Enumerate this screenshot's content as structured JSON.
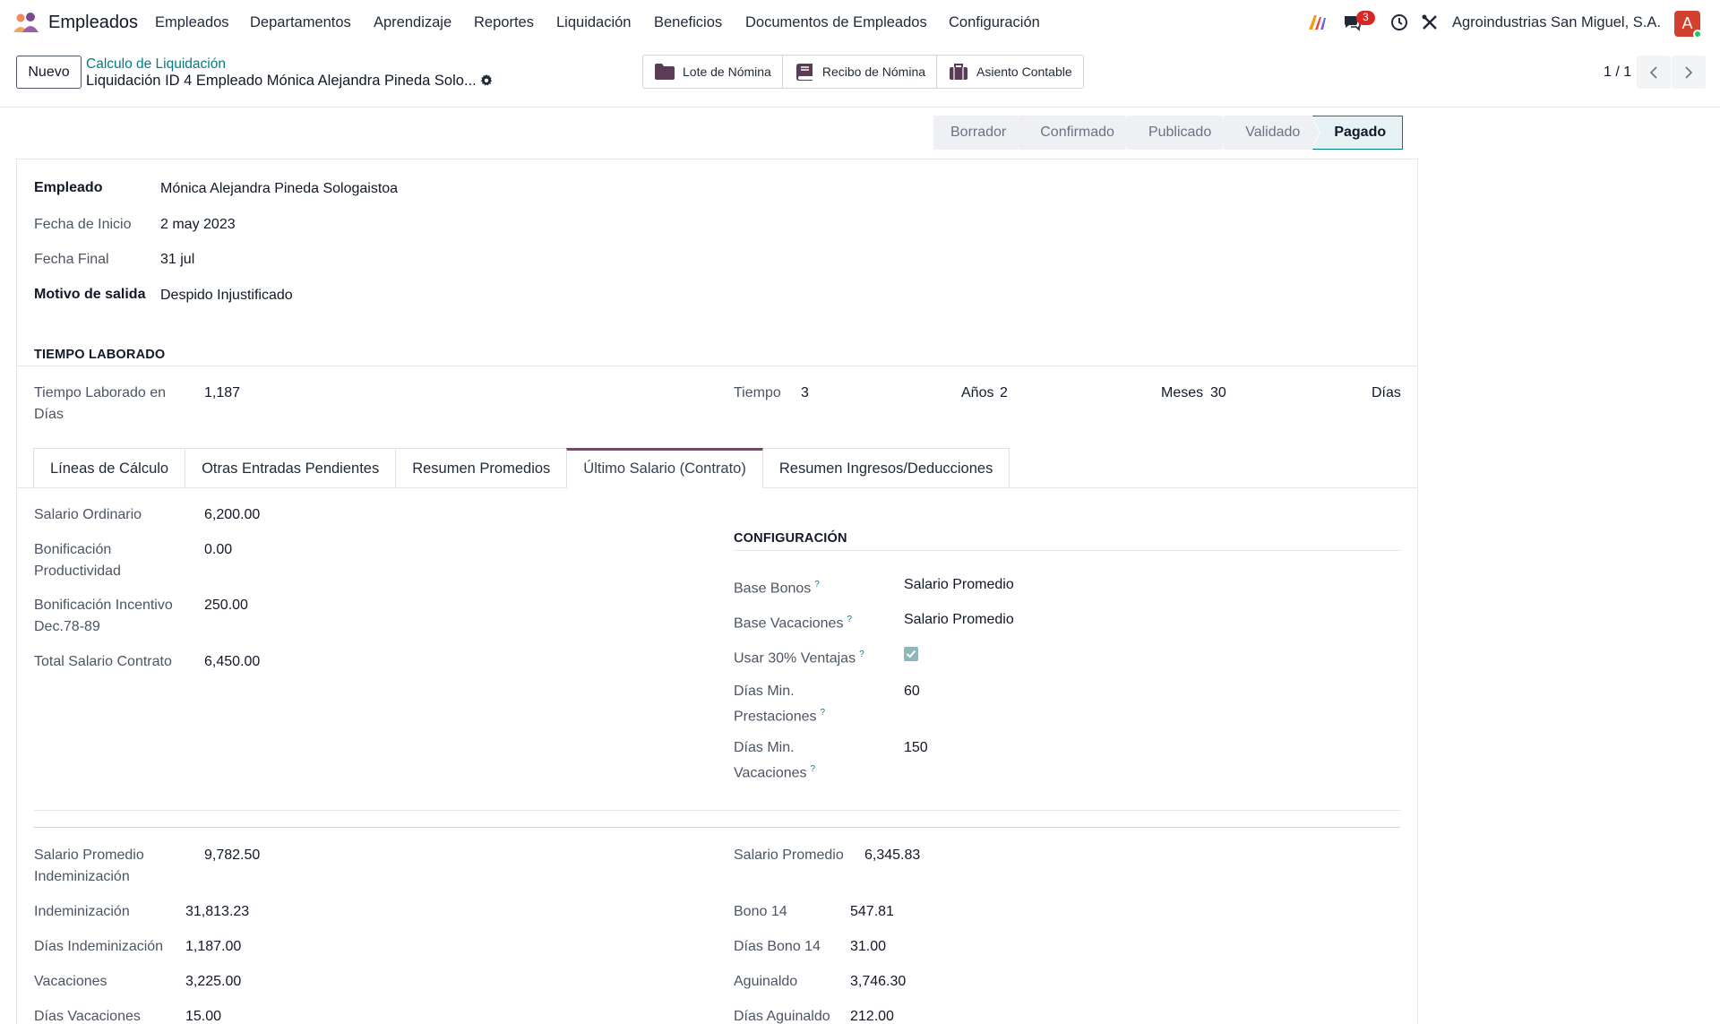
{
  "navbar": {
    "app_name": "Empleados",
    "menu": [
      "Empleados",
      "Departamentos",
      "Aprendizaje",
      "Reportes",
      "Liquidación",
      "Beneficios",
      "Documentos de Empleados",
      "Configuración"
    ],
    "messages_count": "3",
    "company": "Agroindustrias San Miguel, S.A.",
    "avatar_letter": "A"
  },
  "control": {
    "new_label": "Nuevo",
    "breadcrumb": "Calculo de Liquidación",
    "title": "Liquidación ID 4 Empleado Mónica Alejandra Pineda Solo...",
    "smart_buttons": [
      "Lote de Nómina",
      "Recibo de Nómina",
      "Asiento Contable"
    ],
    "pager": "1 / 1"
  },
  "status": {
    "stages": [
      "Borrador",
      "Confirmado",
      "Publicado",
      "Validado",
      "Pagado"
    ],
    "active": "Pagado"
  },
  "header_fields": {
    "employee_label": "Empleado",
    "employee_value": "Mónica Alejandra Pineda Sologaistoa",
    "start_label": "Fecha de Inicio",
    "start_value": "2 may 2023",
    "end_label": "Fecha Final",
    "end_value": "31 jul",
    "reason_label": "Motivo de salida",
    "reason_value": "Despido Injustificado"
  },
  "worked_time": {
    "section_title": "TIEMPO LABORADO",
    "days_label": "Tiempo Laborado en Días",
    "days_value": "1,187",
    "time_label": "Tiempo",
    "years_value": "3",
    "years_label": "Años",
    "months_value": "2",
    "months_label": "Meses",
    "day_value": "30",
    "day_label": "Días"
  },
  "tabs": [
    "Líneas de Cálculo",
    "Otras Entradas Pendientes",
    "Resumen Promedios",
    "Último Salario (Contrato)",
    "Resumen Ingresos/Deducciones"
  ],
  "active_tab": "Último Salario (Contrato)",
  "salary": {
    "ordinary_label": "Salario Ordinario",
    "ordinary_value": "6,200.00",
    "productivity_label": "Bonificación Productividad",
    "productivity_value": "0.00",
    "incentive_label": "Bonificación Incentivo Dec.78-89",
    "incentive_value": "250.00",
    "total_label": "Total Salario Contrato",
    "total_value": "6,450.00"
  },
  "config": {
    "section_title": "CONFIGURACIÓN",
    "base_bonus_label": "Base Bonos",
    "base_bonus_value": "Salario Promedio",
    "base_vacation_label": "Base Vacaciones",
    "base_vacation_value": "Salario Promedio",
    "use30_label": "Usar 30% Ventajas",
    "use30_checked": true,
    "min_benefits_label": "Días Min. Prestaciones",
    "min_benefits_value": "60",
    "min_vacation_label": "Días Min. Vacaciones",
    "min_vacation_value": "150"
  },
  "totals_left": {
    "avg_indem_label": "Salario Promedio Indeminización",
    "avg_indem_value": "9,782.50",
    "indem_label": "Indeminización",
    "indem_value": "31,813.23",
    "indem_days_label": "Días Indeminización",
    "indem_days_value": "1,187.00",
    "vacation_label": "Vacaciones",
    "vacation_value": "3,225.00",
    "vacation_days_label": "Días Vacaciones",
    "vacation_days_value": "15.00"
  },
  "totals_right": {
    "avg_label": "Salario Promedio",
    "avg_value": "6,345.83",
    "bono14_label": "Bono 14",
    "bono14_value": "547.81",
    "bono14_days_label": "Días Bono 14",
    "bono14_days_value": "31.00",
    "aguinaldo_label": "Aguinaldo",
    "aguinaldo_value": "3,746.30",
    "aguinaldo_days_label": "Días Aguinaldo",
    "aguinaldo_days_value": "212.00"
  },
  "colors": {
    "brand_purple": "#714b67",
    "accent_teal": "#017e84",
    "badge_red": "#dc2626"
  }
}
